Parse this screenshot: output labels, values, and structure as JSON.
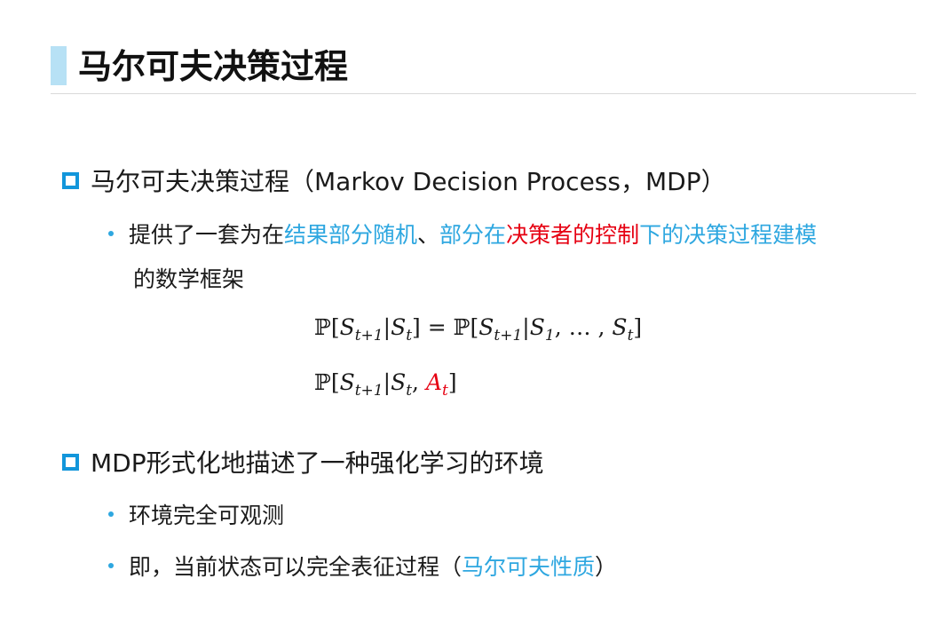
{
  "title": "马尔可夫决策过程",
  "section1": {
    "heading": "马尔可夫决策过程（Markov Decision Process，MDP）",
    "bullet1": {
      "t1": "提供了一套为在",
      "t2": "结果部分随机",
      "t3": "、",
      "t4": "部分在",
      "t5": "决策者的控制",
      "t6": "下的决策过程建模",
      "t7": "的数学框架"
    },
    "formula1": {
      "prob": "ℙ",
      "lb": "[",
      "S": "S",
      "tp1": "t+1",
      "bar": "|",
      "t": "t",
      "rb": "]",
      "eq": " = ",
      "one": "1",
      "sep": ", … , "
    },
    "formula2": {
      "A": "A",
      "comma": ", "
    }
  },
  "section2": {
    "heading": "MDP形式化地描述了一种强化学习的环境",
    "bullet1": "环境完全可观测",
    "bullet2": {
      "t1": "即，当前状态可以完全表征过程（",
      "t2": "马尔可夫性质",
      "t3": "）"
    }
  },
  "colors": {
    "accent_blue": "#2ea7e0",
    "bullet_box": "#1296db",
    "highlight_red": "#e60012",
    "title_bar": "#b7e1f5"
  }
}
